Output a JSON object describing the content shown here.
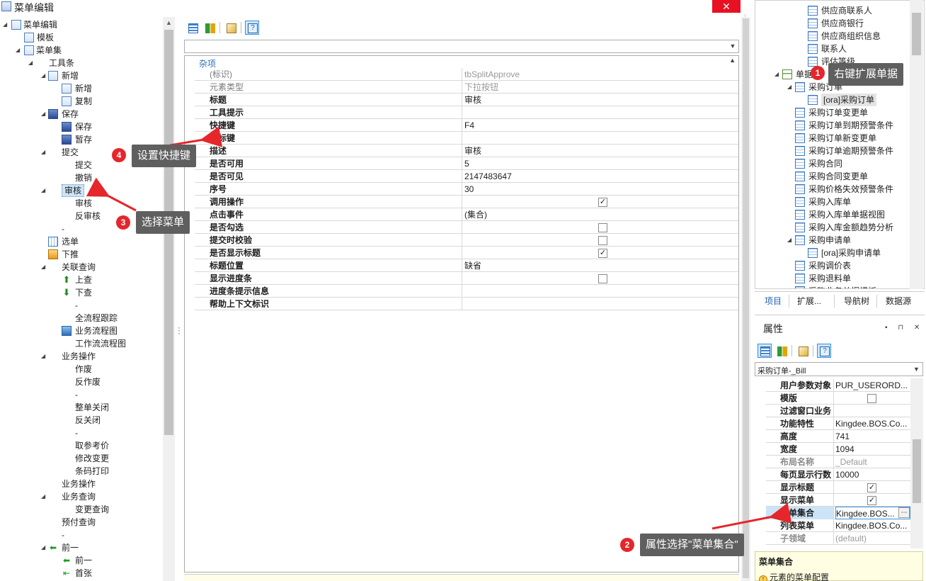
{
  "window": {
    "title": "菜单编辑",
    "close_label": "✕"
  },
  "tree": {
    "rows": [
      {
        "label": "菜单编辑",
        "icon": "doc-icon"
      },
      {
        "label": "模板",
        "icon": "doc-icon"
      },
      {
        "label": "菜单集",
        "icon": "doc-icon"
      },
      {
        "label": "工具条",
        "icon": ""
      },
      {
        "label": "新增",
        "icon": "doc-icon"
      },
      {
        "label": "新增",
        "icon": "doc-icon"
      },
      {
        "label": "复制",
        "icon": "doc-icon"
      },
      {
        "label": "保存",
        "icon": "save-icon"
      },
      {
        "label": "保存",
        "icon": "save-icon"
      },
      {
        "label": "暂存",
        "icon": "save-icon"
      },
      {
        "label": "提交",
        "icon": ""
      },
      {
        "label": "提交",
        "icon": ""
      },
      {
        "label": "撤销",
        "icon": ""
      },
      {
        "label": "审核",
        "icon": ""
      },
      {
        "label": "审核",
        "icon": ""
      },
      {
        "label": "反审核",
        "icon": ""
      },
      {
        "label": "-",
        "icon": ""
      },
      {
        "label": "选单",
        "icon": "grid-icon"
      },
      {
        "label": "下推",
        "icon": "flow-icon"
      },
      {
        "label": "关联查询",
        "icon": ""
      },
      {
        "label": "上查",
        "icon": "up-icon"
      },
      {
        "label": "下查",
        "icon": "down-icon"
      },
      {
        "label": "-",
        "icon": ""
      },
      {
        "label": "全流程跟踪",
        "icon": ""
      },
      {
        "label": "业务流程图",
        "icon": "net-icon"
      },
      {
        "label": "工作流流程图",
        "icon": ""
      },
      {
        "label": "业务操作",
        "icon": ""
      },
      {
        "label": "作废",
        "icon": ""
      },
      {
        "label": "反作废",
        "icon": ""
      },
      {
        "label": "-",
        "icon": ""
      },
      {
        "label": "整单关闭",
        "icon": ""
      },
      {
        "label": "反关闭",
        "icon": ""
      },
      {
        "label": "-",
        "icon": ""
      },
      {
        "label": "取参考价",
        "icon": ""
      },
      {
        "label": "修改变更",
        "icon": ""
      },
      {
        "label": "条码打印",
        "icon": ""
      },
      {
        "label": "业务操作",
        "icon": ""
      },
      {
        "label": "业务查询",
        "icon": ""
      },
      {
        "label": "变更查询",
        "icon": ""
      },
      {
        "label": "预付查询",
        "icon": ""
      },
      {
        "label": "-",
        "icon": ""
      },
      {
        "label": "前一",
        "icon": "left-icon"
      },
      {
        "label": "前一",
        "icon": "left-icon"
      },
      {
        "label": "首张",
        "icon": "first-icon"
      }
    ]
  },
  "grid": {
    "category": "杂项",
    "rows": [
      {
        "name": "(标识)",
        "value": "tbSplitApprove",
        "dim": true
      },
      {
        "name": "元素类型",
        "value": "下拉按钮",
        "dim": true
      },
      {
        "name": "标题",
        "value": "审核"
      },
      {
        "name": "工具提示",
        "value": ""
      },
      {
        "name": "快捷键",
        "value": "F4"
      },
      {
        "name": "图标键",
        "value": ""
      },
      {
        "name": "描述",
        "value": "审核"
      },
      {
        "name": "是否可用",
        "value": "5"
      },
      {
        "name": "是否可见",
        "value": "2147483647"
      },
      {
        "name": "序号",
        "value": "30"
      },
      {
        "name": "调用操作",
        "value": "",
        "check": true,
        "checked": true
      },
      {
        "name": "点击事件",
        "value": "(集合)"
      },
      {
        "name": "是否勾选",
        "value": "",
        "check": true,
        "checked": false
      },
      {
        "name": "提交时校验",
        "value": "",
        "check": true,
        "checked": false
      },
      {
        "name": "是否显示标题",
        "value": "",
        "check": true,
        "checked": true
      },
      {
        "name": "标题位置",
        "value": "缺省"
      },
      {
        "name": "显示进度条",
        "value": "",
        "check": true,
        "checked": false
      },
      {
        "name": "进度条提示信息",
        "value": ""
      },
      {
        "name": "帮助上下文标识",
        "value": ""
      }
    ]
  },
  "right_tree": {
    "rows": [
      {
        "label": "供应商联系人"
      },
      {
        "label": "供应商银行"
      },
      {
        "label": "供应商组织信息"
      },
      {
        "label": "联系人"
      },
      {
        "label": "评估等级"
      },
      {
        "label": "单据"
      },
      {
        "label": "采购订单"
      },
      {
        "label": "[ora]采购订单"
      },
      {
        "label": "采购订单变更单"
      },
      {
        "label": "采购订单到期预警条件"
      },
      {
        "label": "采购订单新变更单"
      },
      {
        "label": "采购订单逾期预警条件"
      },
      {
        "label": "采购合同"
      },
      {
        "label": "采购合同变更单"
      },
      {
        "label": "采购价格失效预警条件"
      },
      {
        "label": "采购入库单"
      },
      {
        "label": "采购入库单单据视图"
      },
      {
        "label": "采购入库金额趋势分析"
      },
      {
        "label": "采购申请单"
      },
      {
        "label": "[ora]采购申请单"
      },
      {
        "label": "采购调价表"
      },
      {
        "label": "采购退料单"
      },
      {
        "label": "采购业务单据模板"
      }
    ],
    "tabs": [
      "项目",
      "扩展...",
      "导航树",
      "数据源"
    ]
  },
  "properties": {
    "title": "属性",
    "window_buttons": "▪ ⊓ ✕",
    "selected_object": "采购订单-_Bill",
    "rows": [
      {
        "name": "用户参数对象",
        "value": "PUR_USERORD..."
      },
      {
        "name": "模版",
        "value": "",
        "check": true,
        "checked": false
      },
      {
        "name": "过滤窗口业务",
        "value": ""
      },
      {
        "name": "功能特性",
        "value": "Kingdee.BOS.Co..."
      },
      {
        "name": "高度",
        "value": "741"
      },
      {
        "name": "宽度",
        "value": "1094"
      },
      {
        "name": "布局名称",
        "value": "_Default",
        "dim": true
      },
      {
        "name": "每页显示行数",
        "value": "10000"
      },
      {
        "name": "显示标题",
        "value": "",
        "check": true,
        "checked": true
      },
      {
        "name": "显示菜单",
        "value": "",
        "check": true,
        "checked": true
      },
      {
        "name": "菜单集合",
        "value": "Kingdee.BOS...",
        "selected": true
      },
      {
        "name": "列表菜单",
        "value": "Kingdee.BOS.Co..."
      },
      {
        "name": "子领域",
        "value": "(default)",
        "dim": true
      }
    ],
    "description_title": "菜单集合",
    "description_text": "元素的菜单配置"
  },
  "annotations": [
    {
      "num": "1",
      "text": "右键扩展单据"
    },
    {
      "num": "2",
      "text": "属性选择\"菜单集合\""
    },
    {
      "num": "3",
      "text": "选择菜单"
    },
    {
      "num": "4",
      "text": "设置快捷键"
    }
  ],
  "colors": {
    "accent": "#3b8fd8",
    "annotation_bg": "#5f5f5f",
    "badge": "#e5262b",
    "arrow": "#e5262b",
    "close": "#e81123"
  }
}
